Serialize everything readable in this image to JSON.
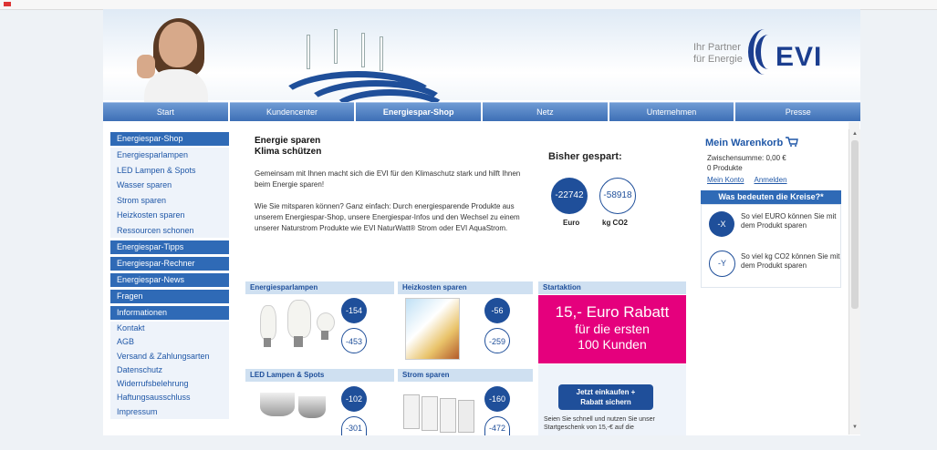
{
  "header": {
    "partner_line1": "Ihr Partner",
    "partner_line2": "für Energie",
    "logo": "EVI"
  },
  "nav": [
    "Start",
    "Kundencenter",
    "Energiespar-Shop",
    "Netz",
    "Unternehmen",
    "Presse"
  ],
  "sidebar": {
    "section1": "Energiespar-Shop",
    "shop_links": [
      "Energiesparlampen",
      "LED Lampen & Spots",
      "Wasser sparen",
      "Strom sparen",
      "Heizkosten sparen",
      "Ressourcen schonen"
    ],
    "section2": "Energiespar-Tipps",
    "section3": "Energiespar-Rechner",
    "section4": "Energiespar-News",
    "section5": "Fragen",
    "section6": "Informationen",
    "info_links": [
      "Kontakt",
      "AGB",
      "Versand & Zahlungsarten",
      "Datenschutz",
      "Widerrufsbelehrung",
      "Haftungsausschluss",
      "Impressum"
    ]
  },
  "intro": {
    "title1": "Energie sparen",
    "title2": "Klima schützen",
    "para1": "Gemeinsam mit Ihnen macht sich die EVI für den Klimaschutz stark und hilft Ihnen beim Energie sparen!",
    "para2": "Wie Sie mitsparen können? Ganz einfach: Durch energiesparende Produkte aus unserem Energiespar-Shop, unsere Energiespar-Infos und den Wechsel zu einem unserer Naturstrom Produkte wie EVI NaturWatt® Strom oder EVI AquaStrom."
  },
  "saved": {
    "title": "Bisher gespart:",
    "euro_value": "-22742",
    "co2_value": "-58918",
    "euro_label": "Euro",
    "co2_label": "kg CO2"
  },
  "products": [
    {
      "title": "Energiesparlampen",
      "euro": "-154",
      "co2": "-453"
    },
    {
      "title": "Heizkosten sparen",
      "euro": "-56",
      "co2": "-259"
    },
    {
      "title": "LED Lampen & Spots",
      "euro": "-102",
      "co2": "-301"
    },
    {
      "title": "Strom sparen",
      "euro": "-160",
      "co2": "-472"
    }
  ],
  "promo": {
    "head": "Startaktion",
    "line1": "15,- Euro Rabatt",
    "line2": "für die ersten",
    "line3": "100 Kunden",
    "button_line1": "Jetzt einkaufen +",
    "button_line2": "Rabatt sichern",
    "text": "Seien Sie schnell und nutzen Sie unser Startgeschenk von 15,-€ auf die"
  },
  "cart": {
    "title": "Mein Warenkorb",
    "subtotal": "Zwischensumme: 0,00 €",
    "count": "0 Produkte",
    "account_link": "Mein Konto",
    "login_link": "Anmelden"
  },
  "kreise": {
    "title": "Was bedeuten die Kreise?*",
    "x_label": "-X",
    "x_text": "So viel EURO können Sie mit dem Produkt sparen",
    "y_label": "-Y",
    "y_text": "So viel kg CO2 können Sie mit dem Produkt sparen"
  },
  "colors": {
    "brand_blue": "#1f4f9a",
    "promo_pink": "#e5007d",
    "nav_blue": "#3d6fb6"
  }
}
